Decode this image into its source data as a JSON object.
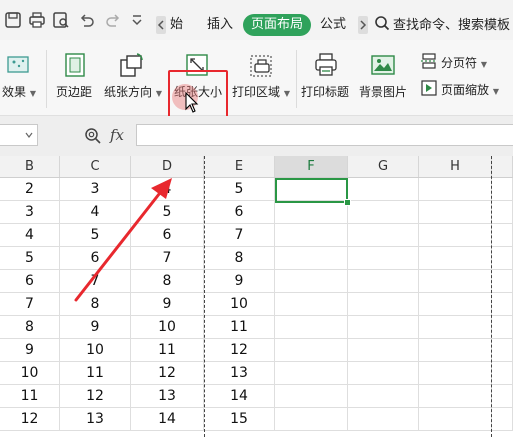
{
  "tabs": {
    "start": "始",
    "insert": "插入",
    "page_layout": "页面布局",
    "formula": "公式"
  },
  "search": {
    "placeholder": "查找命令、搜索模板"
  },
  "ribbon": {
    "effects": "效果",
    "margins": "页边距",
    "orientation": "纸张方向",
    "paper_size": "纸张大小",
    "print_area": "打印区域",
    "print_titles": "打印标题",
    "background": "背景图片",
    "page_break": "分页符",
    "page_zoom": "页面缩放"
  },
  "formula_bar": {
    "fx": "fx"
  },
  "grid": {
    "columns": [
      "B",
      "C",
      "D",
      "E",
      "F",
      "G",
      "H"
    ],
    "selected_column": "F",
    "rows": [
      [
        "2",
        "3",
        "4",
        "5"
      ],
      [
        "3",
        "4",
        "5",
        "6"
      ],
      [
        "4",
        "5",
        "6",
        "7"
      ],
      [
        "5",
        "6",
        "7",
        "8"
      ],
      [
        "6",
        "7",
        "8",
        "9"
      ],
      [
        "7",
        "8",
        "9",
        "10"
      ],
      [
        "8",
        "9",
        "10",
        "11"
      ],
      [
        "9",
        "10",
        "11",
        "12"
      ],
      [
        "10",
        "11",
        "12",
        "13"
      ],
      [
        "11",
        "12",
        "13",
        "14"
      ],
      [
        "12",
        "13",
        "14",
        "15"
      ]
    ]
  },
  "colors": {
    "accent": "#2fa25b",
    "highlight": "#e8282e",
    "annotation_arrow": "#e8282e"
  }
}
